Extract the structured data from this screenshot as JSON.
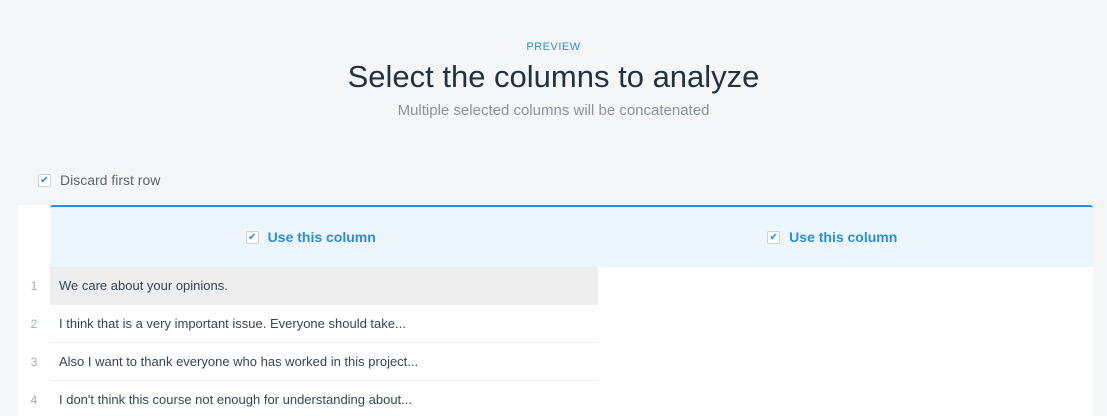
{
  "header": {
    "eyebrow": "PREVIEW",
    "title": "Select the columns to analyze",
    "subtitle": "Multiple selected columns will be concatenated"
  },
  "options": {
    "discard_first_row": {
      "label": "Discard first row",
      "checked": true
    }
  },
  "table": {
    "columns": [
      {
        "label": "Use this column",
        "checked": true
      },
      {
        "label": "Use this column",
        "checked": true
      }
    ],
    "rows": [
      {
        "num": "1",
        "text": "We care about your opinions."
      },
      {
        "num": "2",
        "text": "I think that is a very important issue. Everyone should take..."
      },
      {
        "num": "3",
        "text": "Also I want to thank everyone who has worked in this project..."
      },
      {
        "num": "4",
        "text": "I don't think this course not enough for understanding about..."
      }
    ]
  },
  "colors": {
    "accent": "#2b8ce6",
    "header_bg": "#eef6fd",
    "page_bg": "#f5f6f8",
    "highlight_row": "#ededed"
  },
  "icons": {
    "checkbox_checked": "check-mark"
  }
}
